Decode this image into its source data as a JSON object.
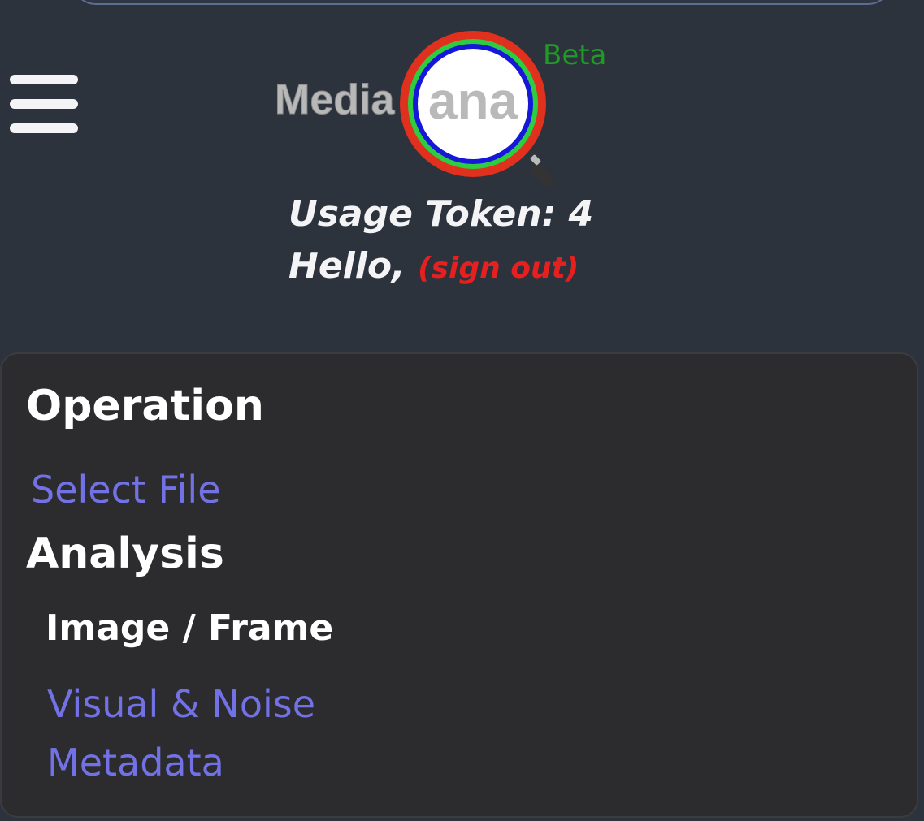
{
  "header": {
    "logo_text_left": "Media",
    "logo_text_center": "ana",
    "beta_label": "Beta",
    "menu_icon": "hamburger-menu-icon"
  },
  "user": {
    "usage_token_line": "Usage Token: 4",
    "hello_text": "Hello, ",
    "sign_out_label": "(sign out)"
  },
  "panel": {
    "operation_heading": "Operation",
    "select_file_label": "Select File",
    "analysis_heading": "Analysis",
    "image_frame_heading": "Image / Frame",
    "visual_noise_label": "Visual & Noise",
    "metadata_label": "Metadata"
  },
  "colors": {
    "background": "#2d333d",
    "panel": "#2c2c2e",
    "link": "#7272e6",
    "sign_out": "#e5201f",
    "beta": "#1f9a26",
    "ring_red": "#e0301e",
    "ring_green": "#2ecc40",
    "ring_blue": "#1717d9"
  }
}
